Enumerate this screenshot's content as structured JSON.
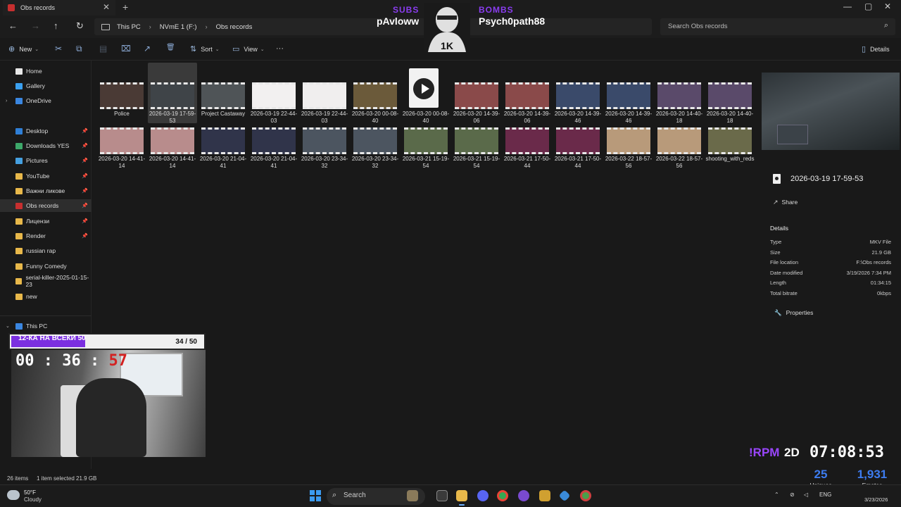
{
  "window": {
    "tab_title": "Obs records",
    "new_tab": "+",
    "close": "✕",
    "minimize": "—",
    "maximize": "▢",
    "close_window": "✕"
  },
  "address": {
    "back": "←",
    "forward": "→",
    "up": "↑",
    "refresh": "↻",
    "crumbs": [
      "This PC",
      "NVmE 1 (F:)",
      "Obs records"
    ],
    "sep": "›",
    "search_placeholder": "Search Obs records"
  },
  "toolbar": {
    "new_label": "New",
    "sort_label": "Sort",
    "view_label": "View",
    "more": "···",
    "details_label": "Details",
    "cut_icon": "✂",
    "copy_icon": "⧉",
    "paste_icon": "▤",
    "rename_icon": "⌧",
    "share_icon": "↗",
    "delete_icon": "🗑"
  },
  "sidebar": {
    "items": [
      {
        "label": "Home",
        "color": "#e8e8e8",
        "pinned": false,
        "chev": ""
      },
      {
        "label": "Gallery",
        "color": "#3aa0f0",
        "pinned": false,
        "chev": ""
      },
      {
        "label": "OneDrive",
        "color": "#3a86e0",
        "pinned": false,
        "chev": "›"
      },
      {
        "label": "Desktop",
        "color": "#2f7fd6",
        "pinned": true,
        "chev": ""
      },
      {
        "label": "Downloads YES",
        "color": "#3da86a",
        "pinned": true,
        "chev": ""
      },
      {
        "label": "Pictures",
        "color": "#45a0e0",
        "pinned": true,
        "chev": ""
      },
      {
        "label": "YouTube",
        "color": "#e8b84a",
        "pinned": true,
        "chev": ""
      },
      {
        "label": "Важни ликове",
        "color": "#e8b84a",
        "pinned": true,
        "chev": ""
      },
      {
        "label": "Obs records",
        "color": "#c62f2f",
        "pinned": true,
        "chev": ""
      },
      {
        "label": "Лицензи",
        "color": "#e8b84a",
        "pinned": true,
        "chev": ""
      },
      {
        "label": "Render",
        "color": "#e8b84a",
        "pinned": true,
        "chev": ""
      },
      {
        "label": "russian rap",
        "color": "#e8b84a",
        "pinned": false,
        "chev": ""
      },
      {
        "label": "Funny Comedy",
        "color": "#e8b84a",
        "pinned": false,
        "chev": ""
      },
      {
        "label": "serial-killer-2025-01-15-23",
        "color": "#e8b84a",
        "pinned": false,
        "chev": ""
      },
      {
        "label": "new",
        "color": "#e8b84a",
        "pinned": false,
        "chev": ""
      },
      {
        "label": "This PC",
        "color": "#3a86e0",
        "pinned": false,
        "chev": "⌄"
      }
    ],
    "pin_icon": "📌"
  },
  "files": [
    {
      "label": "Police",
      "color": "#4a3a35"
    },
    {
      "label": "2026-03-19 17-59-53",
      "color": "#3f4448"
    },
    {
      "label": "Project Castaway",
      "color": "#4f5457"
    },
    {
      "label": "2026-03-19 22-44-03",
      "color": "#f2f0f0"
    },
    {
      "label": "2026-03-19 22-44-03",
      "color": "#f0eeee"
    },
    {
      "label": "2026-03-20 00-08-40",
      "color": "#6b5a3a"
    },
    {
      "label": "2026-03-20 00-08-40",
      "color": "video"
    },
    {
      "label": "2026-03-20 14-39-06",
      "color": "#8a4a4a"
    },
    {
      "label": "2026-03-20 14-39-06",
      "color": "#8a4a4a"
    },
    {
      "label": "2026-03-20 14-39-46",
      "color": "#3a4a6a"
    },
    {
      "label": "2026-03-20 14-39-46",
      "color": "#3a4a6a"
    },
    {
      "label": "2026-03-20 14-40-18",
      "color": "#5a4a6a"
    },
    {
      "label": "2026-03-20 14-40-18",
      "color": "#5a4a6a"
    },
    {
      "label": "2026-03-20 14-41-14",
      "color": "#b88c8c"
    },
    {
      "label": "2026-03-20 14-41-14",
      "color": "#b88c8c"
    },
    {
      "label": "2026-03-20 21-04-41",
      "color": "#30344a"
    },
    {
      "label": "2026-03-20 21-04-41",
      "color": "#30344a"
    },
    {
      "label": "2026-03-20 23-34-32",
      "color": "#4c5560"
    },
    {
      "label": "2026-03-20 23-34-32",
      "color": "#4c5560"
    },
    {
      "label": "2026-03-21 15-19-54",
      "color": "#5a6a4a"
    },
    {
      "label": "2026-03-21 15-19-54",
      "color": "#5a6a4a"
    },
    {
      "label": "2026-03-21 17-50-44",
      "color": "#6a2a4a"
    },
    {
      "label": "2026-03-21 17-50-44",
      "color": "#6a2a4a"
    },
    {
      "label": "2026-03-22 18-57-56",
      "color": "#b89a7a"
    },
    {
      "label": "2026-03-22 18-57-56",
      "color": "#b89a7a"
    },
    {
      "label": "shooting_with_reds",
      "color": "#6a6a4a"
    }
  ],
  "details": {
    "filename": "2026-03-19 17-59-53",
    "share_label": "Share",
    "share_icon": "↗",
    "heading": "Details",
    "props": [
      {
        "k": "Type",
        "v": "MKV File"
      },
      {
        "k": "Size",
        "v": "21.9 GB"
      },
      {
        "k": "File location",
        "v": "F:\\Obs records"
      },
      {
        "k": "Date modified",
        "v": "3/19/2026 7:34 PM"
      },
      {
        "k": "Length",
        "v": "01:34:15"
      },
      {
        "k": "Total bitrate",
        "v": "0kbps"
      }
    ],
    "properties_label": "Properties",
    "properties_icon": "🔧"
  },
  "status": {
    "items": "26 items",
    "selected": "1 item selected  21.9 GB"
  },
  "overlay": {
    "subs_label": "SUBS",
    "subs_name": "pAvloww",
    "bombs_label": "BOMBS",
    "bombs_name": "Psych0path88",
    "mascot_text": "1K",
    "goal_text": "12-КА НА ВСЕКИ 50",
    "goal_count": "34 / 50",
    "goal_progress": 0.68,
    "timer_hm": "00 : 36 :",
    "timer_s": "57",
    "rpm": "!RPM",
    "days": "2D",
    "clock": "07:08:53",
    "uniques_num": "25",
    "uniques_lbl": "Uniques",
    "emotes_num": "1,931",
    "emotes_lbl": "Emotes"
  },
  "taskbar": {
    "temp": "50°F",
    "condition": "Cloudy",
    "search_label": "Search",
    "search_icon": "⌕",
    "lang": "ENG",
    "date": "3/23/2026",
    "tray_up": "⌃"
  }
}
